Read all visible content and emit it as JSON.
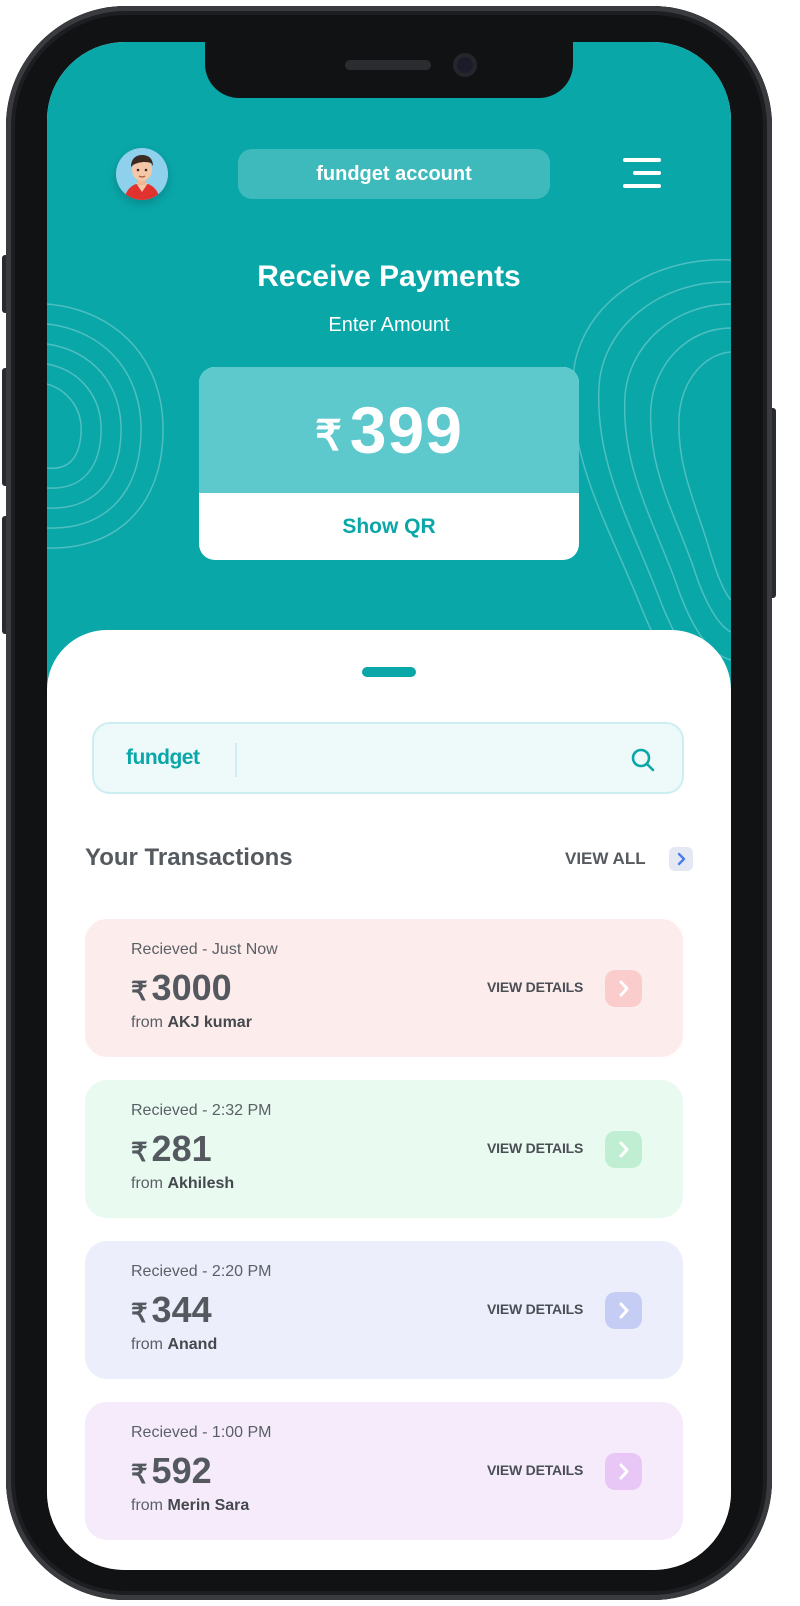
{
  "header": {
    "account_label": "fundget account"
  },
  "receive": {
    "title": "Receive Payments",
    "subtitle": "Enter Amount",
    "currency_symbol": "₹",
    "amount": "399",
    "show_qr_label": "Show QR"
  },
  "search": {
    "brand": "fundget",
    "placeholder": "",
    "icon": "search-icon"
  },
  "transactions": {
    "title": "Your Transactions",
    "view_all_label": "VIEW ALL",
    "items": [
      {
        "status": "Recieved - Just Now",
        "currency": "₹",
        "amount": "3000",
        "from_prefix": "from",
        "from_name": "AKJ kumar",
        "action": "VIEW DETAILS",
        "bg": "#fdecec",
        "accent": "#fbcccc"
      },
      {
        "status": "Recieved - 2:32 PM",
        "currency": "₹",
        "amount": "281",
        "from_prefix": "from",
        "from_name": "Akhilesh",
        "action": "VIEW DETAILS",
        "bg": "#e9fbf1",
        "accent": "#bfeed3"
      },
      {
        "status": "Recieved - 2:20 PM",
        "currency": "₹",
        "amount": "344",
        "from_prefix": "from",
        "from_name": "Anand",
        "action": "VIEW DETAILS",
        "bg": "#eceffb",
        "accent": "#c6cdf5"
      },
      {
        "status": "Recieved - 1:00 PM",
        "currency": "₹",
        "amount": "592",
        "from_prefix": "from",
        "from_name": "Merin Sara",
        "action": "VIEW DETAILS",
        "bg": "#f6ebfb",
        "accent": "#e8c6f6"
      }
    ]
  },
  "colors": {
    "brand_teal": "#0aa7a9",
    "amount_panel": "#5dc9cd",
    "text_dark": "#555a5f"
  }
}
